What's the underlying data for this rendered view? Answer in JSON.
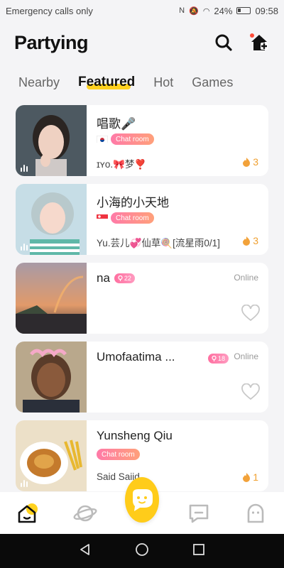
{
  "status": {
    "carrier": "Emergency calls only",
    "battery": "24%",
    "time": "09:58"
  },
  "header": {
    "title": "Partying",
    "search_icon": "search-icon",
    "home_icon": "home-icon"
  },
  "tabs": [
    {
      "label": "Nearby",
      "active": false
    },
    {
      "label": "Featured",
      "active": true
    },
    {
      "label": "Hot",
      "active": false
    },
    {
      "label": "Games",
      "active": false
    }
  ],
  "cards": [
    {
      "name": "唱歌🎤",
      "flag": "kr",
      "chip": "Chat room",
      "subtitle": "ɪʏᴏ.🎀梦❣️",
      "count": "3",
      "colors": [
        "#4a5a63",
        "#e7c6b6"
      ]
    },
    {
      "name": "小海的小天地",
      "flag": "sg",
      "chip": "Chat room",
      "subtitle": "Yu.芸儿💞仙草🍭[流星雨0/1]",
      "count": "3",
      "colors": [
        "#bdd9e3",
        "#f2d2c4"
      ]
    },
    {
      "name": "na",
      "level": "22",
      "status": "Online",
      "colors": [
        "#d98a5a",
        "#3b3540"
      ]
    },
    {
      "name": "Umofaatima ...",
      "level": "18",
      "status": "Online",
      "colors": [
        "#c9b08f",
        "#4a3426"
      ]
    },
    {
      "name": "Yunsheng Qiu",
      "chip": "Chat room",
      "subtitle": "Said Saiid",
      "count": "1",
      "colors": [
        "#e8d6b8",
        "#c77a2e"
      ]
    }
  ]
}
